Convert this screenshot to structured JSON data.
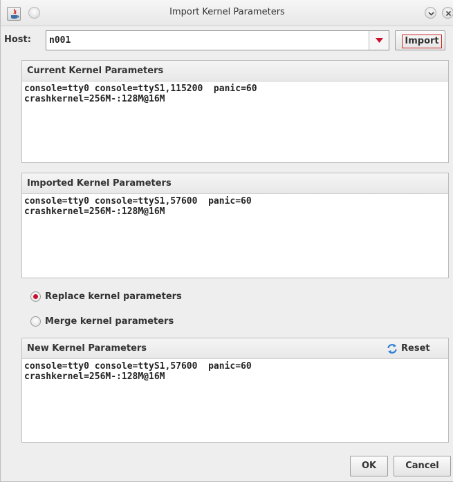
{
  "window": {
    "title": "Import Kernel Parameters",
    "icons": [
      "java-app-icon",
      "menu-circle-icon",
      "minimize-icon",
      "close-icon"
    ]
  },
  "host": {
    "label": "Host:",
    "value": "n001",
    "import_label": "Import"
  },
  "current": {
    "title": "Current Kernel Parameters",
    "text": "console=tty0 console=ttyS1,115200  panic=60\ncrashkernel=256M-:128M@16M"
  },
  "imported": {
    "title": "Imported Kernel Parameters",
    "text": "console=tty0 console=ttyS1,57600  panic=60\ncrashkernel=256M-:128M@16M"
  },
  "options": {
    "replace_label": "Replace kernel parameters",
    "merge_label": "Merge kernel parameters",
    "selected": "replace"
  },
  "new_params": {
    "title": "New Kernel Parameters",
    "reset_label": "Reset",
    "text": "console=tty0 console=ttyS1,57600  panic=60\ncrashkernel=256M-:128M@16M"
  },
  "buttons": {
    "ok": "OK",
    "cancel": "Cancel"
  },
  "colors": {
    "accent_red": "#c8102e",
    "window_bg": "#eeeeee"
  }
}
